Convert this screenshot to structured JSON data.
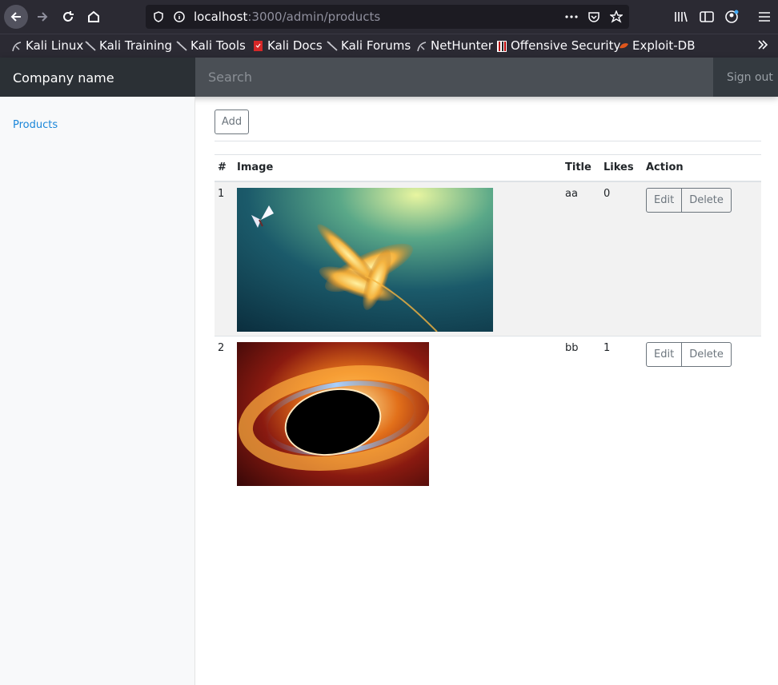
{
  "browser": {
    "url_host": "localhost",
    "url_path": ":3000/admin/products",
    "bookmarks": [
      "Kali Linux",
      "Kali Training",
      "Kali Tools",
      "Kali Docs",
      "Kali Forums",
      "NetHunter",
      "Offensive Security",
      "Exploit-DB"
    ]
  },
  "navbar": {
    "brand": "Company name",
    "search_placeholder": "Search",
    "signout": "Sign out"
  },
  "sidebar": {
    "items": [
      {
        "label": "Products"
      }
    ]
  },
  "main": {
    "add_label": "Add",
    "columns": [
      "#",
      "Image",
      "Title",
      "Likes",
      "Action"
    ],
    "rows": [
      {
        "num": "1",
        "title": "aa",
        "likes": "0"
      },
      {
        "num": "2",
        "title": "bb",
        "likes": "1"
      }
    ],
    "edit_label": "Edit",
    "delete_label": "Delete"
  },
  "colors": {
    "accent": "#1a86d9",
    "navbar": "#343a40"
  }
}
